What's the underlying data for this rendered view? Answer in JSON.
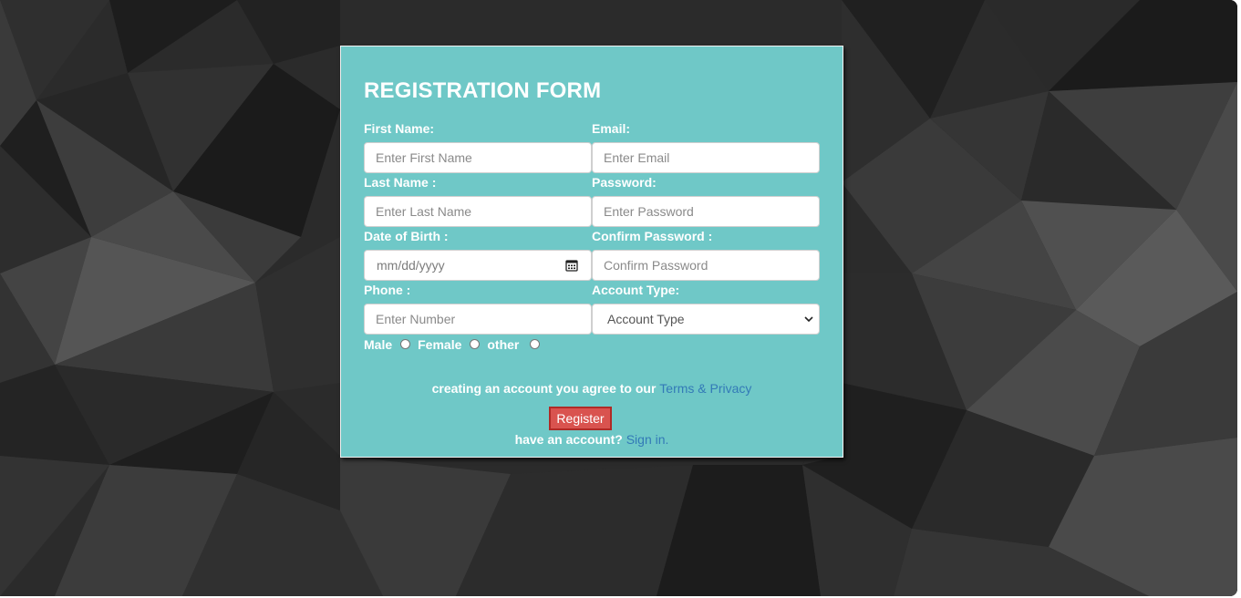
{
  "form": {
    "title": "REGISTRATION FORM",
    "first_name": {
      "label": "First Name:",
      "placeholder": "Enter First Name"
    },
    "last_name": {
      "label": "Last Name :",
      "placeholder": "Enter Last Name"
    },
    "dob": {
      "label": "Date of Birth :",
      "placeholder": "mm/dd/yyyy"
    },
    "phone": {
      "label": "Phone :",
      "placeholder": "Enter Number"
    },
    "email": {
      "label": "Email:",
      "placeholder": "Enter Email"
    },
    "password": {
      "label": "Password:",
      "placeholder": "Enter Password"
    },
    "confirm_password": {
      "label": "Confirm Password :",
      "placeholder": "Confirm Password"
    },
    "account_type": {
      "label": "Account Type:",
      "selected": "Account Type"
    },
    "gender": {
      "options": [
        "Male",
        "Female",
        "other"
      ]
    },
    "agree_text": "creating an account you agree to our",
    "terms_link": "Terms & Privacy",
    "register_label": "Register",
    "have_account_text": "have an account?",
    "signin_link": "Sign in",
    "signin_suffix": "."
  },
  "colors": {
    "card_bg": "#6fc8c7",
    "register_bg": "#d9534f",
    "link": "#337ab7",
    "page_bg": "#2a2a2a"
  }
}
